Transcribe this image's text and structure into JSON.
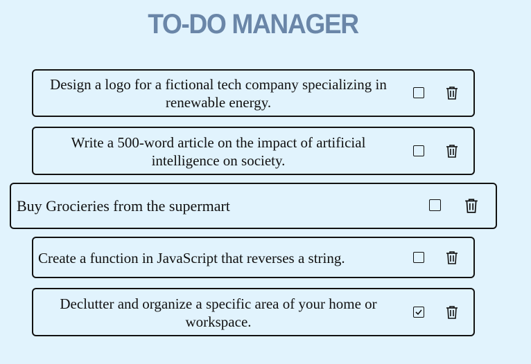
{
  "app": {
    "title": "TO-DO MANAGER"
  },
  "tasks": [
    {
      "text": "Design a logo for a fictional tech company specializing in renewable energy.",
      "checked": false
    },
    {
      "text": "Write a 500-word article on the impact of artificial intelligence on society.",
      "checked": false
    },
    {
      "text": "Buy Grocieries from the supermart",
      "checked": false
    },
    {
      "text": "Create a function in JavaScript that reverses a string.",
      "checked": false
    },
    {
      "text": "Declutter and organize a specific area of your home or workspace.",
      "checked": true
    }
  ],
  "icons": {
    "checkbox": "checkbox-icon",
    "delete": "trash-icon"
  },
  "colors": {
    "background": "#e1f3fd",
    "title": "#6a86a8",
    "border": "#111111"
  }
}
